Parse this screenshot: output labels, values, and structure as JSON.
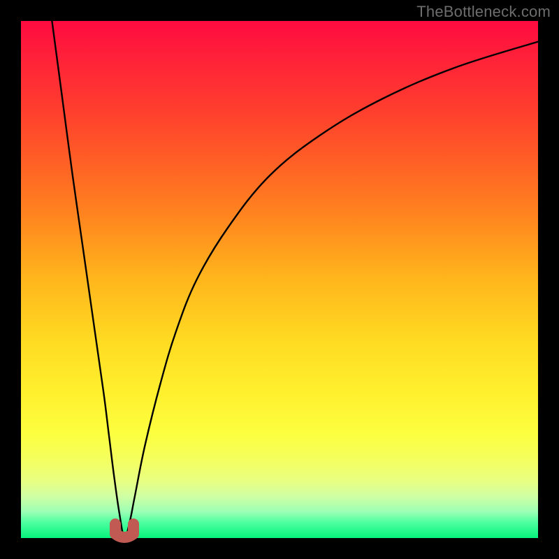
{
  "watermark": "TheBottleneck.com",
  "colors": {
    "background": "#000000",
    "gradient_top": "#ff0a40",
    "gradient_bottom": "#05f37c",
    "curve": "#000000",
    "notch": "#c05a52"
  },
  "chart_data": {
    "type": "line",
    "title": "",
    "xlabel": "",
    "ylabel": "",
    "xlim": [
      0,
      100
    ],
    "ylim": [
      0,
      100
    ],
    "series": [
      {
        "name": "bottleneck-curve",
        "x": [
          6,
          8,
          10,
          12,
          14,
          16,
          17,
          18,
          19,
          20,
          21,
          22,
          24,
          27,
          30,
          34,
          40,
          48,
          58,
          70,
          84,
          100
        ],
        "values": [
          100,
          85,
          70,
          56,
          42,
          28,
          20,
          12,
          5,
          0,
          3,
          8,
          18,
          30,
          40,
          50,
          60,
          70,
          78,
          85,
          91,
          96
        ]
      }
    ],
    "annotations": [
      {
        "name": "min-notch",
        "x": 20,
        "y": 0
      }
    ]
  }
}
